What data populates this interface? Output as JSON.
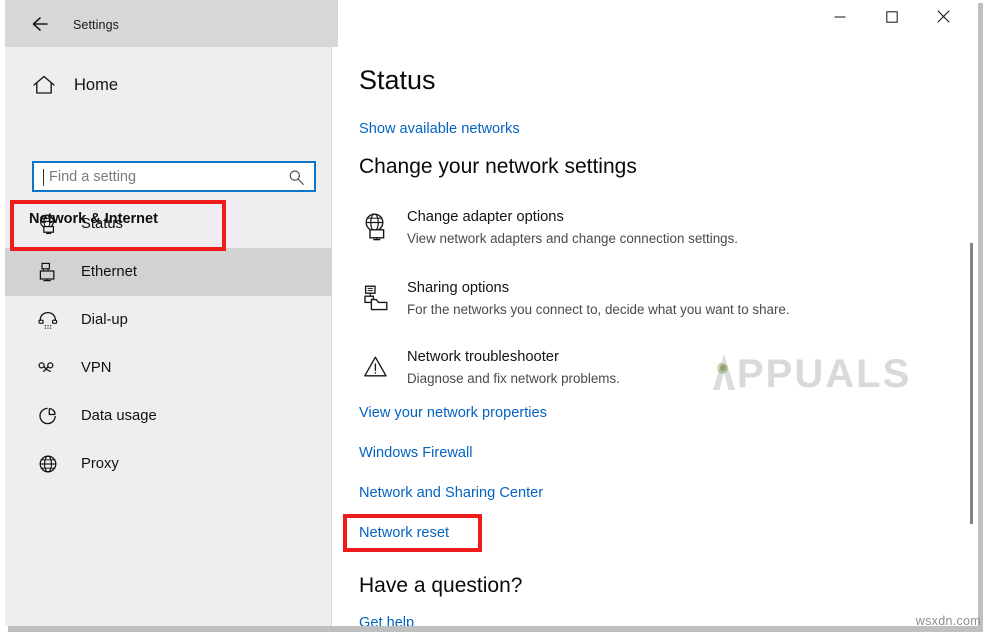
{
  "window": {
    "title": "Settings",
    "back_icon": "back-arrow-icon",
    "controls": {
      "minimize": "–",
      "maximize": "▢",
      "close": "✕"
    }
  },
  "sidebar": {
    "home_label": "Home",
    "home_icon": "home-icon",
    "search": {
      "placeholder": "Find a setting",
      "value": "",
      "icon": "search-icon"
    },
    "section_title": "Network & Internet",
    "items": [
      {
        "label": "Status",
        "icon": "globe-monitor-icon",
        "state": "annotated"
      },
      {
        "label": "Ethernet",
        "icon": "ethernet-icon",
        "state": "hover"
      },
      {
        "label": "Dial-up",
        "icon": "telephone-icon",
        "state": "normal"
      },
      {
        "label": "VPN",
        "icon": "vpn-icon",
        "state": "normal"
      },
      {
        "label": "Data usage",
        "icon": "pie-chart-icon",
        "state": "normal"
      },
      {
        "label": "Proxy",
        "icon": "globe-icon",
        "state": "normal"
      }
    ]
  },
  "content": {
    "page_title": "Status",
    "show_networks_link": "Show available networks",
    "settings_heading": "Change your network settings",
    "options": [
      {
        "title": "Change adapter options",
        "desc": "View network adapters and change connection settings.",
        "icon": "globe-monitor-icon"
      },
      {
        "title": "Sharing options",
        "desc": "For the networks you connect to, decide what you want to share.",
        "icon": "shared-folder-icon"
      },
      {
        "title": "Network troubleshooter",
        "desc": "Diagnose and fix network problems.",
        "icon": "warning-triangle-icon"
      }
    ],
    "links": [
      {
        "label": "View your network properties",
        "state": "normal"
      },
      {
        "label": "Windows Firewall",
        "state": "normal"
      },
      {
        "label": "Network and Sharing Center",
        "state": "normal"
      },
      {
        "label": "Network reset",
        "state": "annotated"
      }
    ],
    "bottom_heading": "Have a question?",
    "get_help_link": "Get help"
  },
  "watermarks": {
    "appuals": "PPUALS",
    "wsxdn": "wsxdn.com"
  },
  "colors": {
    "accent_blue": "#0563c1",
    "annotation_red": "#ee1c1c",
    "sidebar_bg": "#eeeef0",
    "titlebar_bg": "#d7d7d7",
    "hover_gray": "#d2d2d2"
  }
}
